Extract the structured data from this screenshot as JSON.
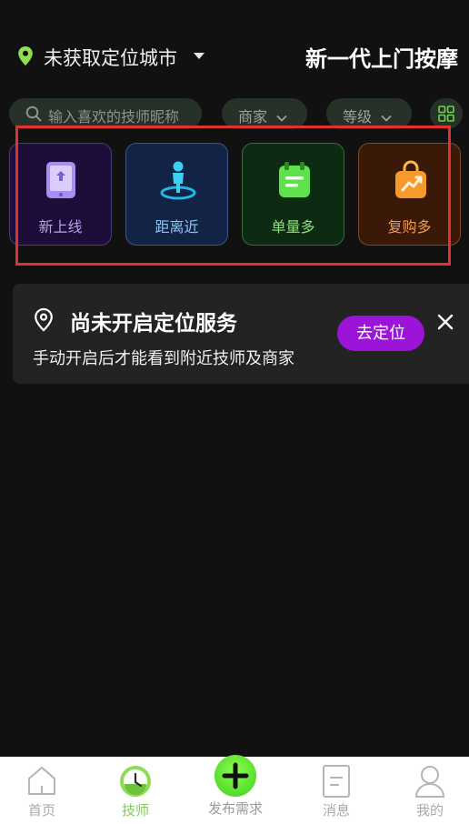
{
  "header": {
    "location_text": "未获取定位城市",
    "brand_title": "新一代上门按摩"
  },
  "search": {
    "placeholder": "输入喜欢的技师昵称"
  },
  "filters": [
    {
      "label": "商家"
    },
    {
      "label": "等级"
    }
  ],
  "categories": [
    {
      "label": "新上线",
      "icon": "tablet-upload-icon"
    },
    {
      "label": "距离近",
      "icon": "person-pin-icon"
    },
    {
      "label": "单量多",
      "icon": "calendar-notes-icon"
    },
    {
      "label": "复购多",
      "icon": "shopping-bag-trend-icon"
    }
  ],
  "notice": {
    "title": "尚未开启定位服务",
    "description": "手动开启后才能看到附近技师及商家",
    "action_label": "去定位"
  },
  "tabbar": {
    "tabs": [
      {
        "label": "首页",
        "icon": "home-icon"
      },
      {
        "label": "技师",
        "icon": "clock-icon",
        "active": true
      },
      {
        "label": "发布需求",
        "icon": "plus-icon"
      },
      {
        "label": "消息",
        "icon": "document-icon"
      },
      {
        "label": "我的",
        "icon": "user-icon"
      }
    ]
  },
  "colors": {
    "accent_green": "#7ad04a",
    "action_purple": "#9b14d8",
    "background": "#111111"
  }
}
